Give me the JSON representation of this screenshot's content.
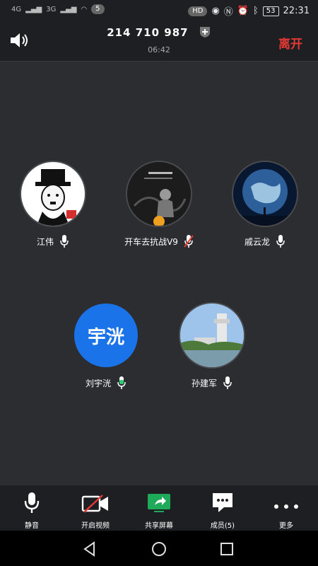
{
  "status_bar": {
    "network1": "4G",
    "network2": "3G",
    "notification_count": "5",
    "hd_label": "HD",
    "battery": "53",
    "time": "22:31"
  },
  "header": {
    "meeting_id": "214 710 987",
    "duration": "06:42",
    "leave_label": "离开"
  },
  "participants": [
    {
      "name": "江伟",
      "avatar": "charlie-chaplin-avatar",
      "mic": "on"
    },
    {
      "name": "开车去抗战V9",
      "avatar": "dark-portrait-avatar",
      "mic": "muted",
      "badge": "host-icon"
    },
    {
      "name": "戚云龙",
      "avatar": "earth-avatar",
      "mic": "on"
    },
    {
      "name": "刘宇洸",
      "avatar_text": "宇洸",
      "avatar_color": "#1a73e8",
      "mic": "speaking"
    },
    {
      "name": "孙建军",
      "avatar": "building-photo-avatar",
      "mic": "on"
    }
  ],
  "toolbar": {
    "mute_label": "静音",
    "video_label": "开启视频",
    "share_label": "共享屏幕",
    "members_label": "成员(5)",
    "more_label": "更多"
  },
  "colors": {
    "accent_blue": "#1a73e8",
    "leave_red": "#e53935",
    "speaking_green": "#2ecc71",
    "share_green": "#1faa59"
  }
}
